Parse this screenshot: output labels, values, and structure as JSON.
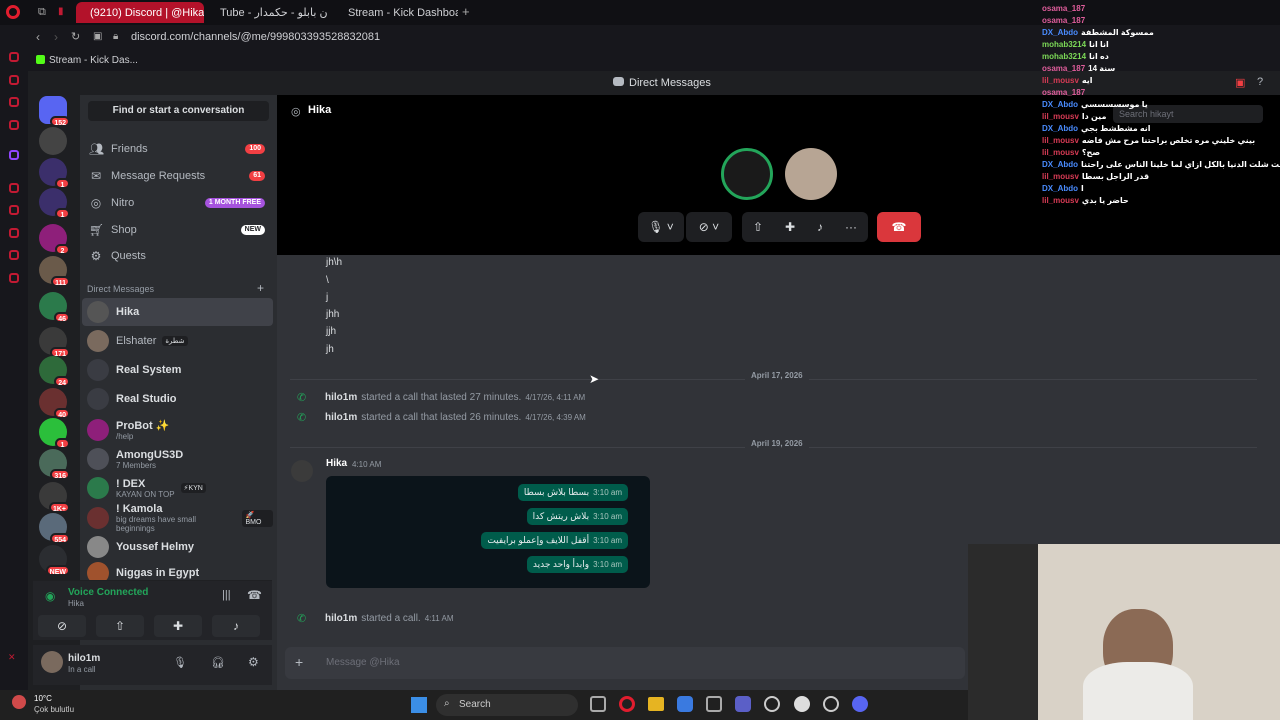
{
  "browser": {
    "tabs": [
      {
        "label": "(9210) Discord | @Hika",
        "active": true
      },
      {
        "label": "Tube - مروان بابلو - حكمدار"
      },
      {
        "label": "Stream - Kick Dashboard"
      }
    ],
    "url": "discord.com/channels/@me/999803393528832081",
    "bookmark": "Stream - Kick Das..."
  },
  "header": {
    "title": "Direct Messages"
  },
  "sidebar": {
    "search_label": "Find or start a conversation",
    "nav": [
      {
        "label": "Friends",
        "icon": "friends-icon",
        "badge": "100"
      },
      {
        "label": "Message Requests",
        "icon": "mail-icon",
        "badge": "61"
      },
      {
        "label": "Nitro",
        "icon": "nitro-icon",
        "badge": "1 MONTH FREE"
      },
      {
        "label": "Shop",
        "icon": "shop-icon",
        "badge": "NEW"
      },
      {
        "label": "Quests",
        "icon": "quests-icon"
      }
    ],
    "dm_header": "Direct Messages",
    "dms": [
      {
        "name": "Hika",
        "sub": ""
      },
      {
        "name": "Elshater",
        "sub": "",
        "tag": "شطرة"
      },
      {
        "name": "Real System",
        "sub": ""
      },
      {
        "name": "Real Studio",
        "sub": ""
      },
      {
        "name": "ProBot ✨",
        "sub": "/help"
      },
      {
        "name": "AmongUS3D",
        "sub": "7 Members"
      },
      {
        "name": "! DEX",
        "sub": "KAYAN ON TOP",
        "tag": "⚡KYN"
      },
      {
        "name": "! Kamola",
        "sub": "big dreams have small beginnings",
        "tag": "🚀BMO"
      },
      {
        "name": "Youssef Helmy",
        "sub": ""
      },
      {
        "name": "Niggas in Egypt",
        "sub": ""
      }
    ]
  },
  "servers": [
    {
      "badge": "152"
    },
    {
      "badge": ""
    },
    {
      "badge": "1"
    },
    {
      "badge": "1"
    },
    {
      "badge": "2"
    },
    {
      "badge": "111"
    },
    {
      "badge": "46"
    },
    {
      "badge": "171"
    },
    {
      "badge": "24"
    },
    {
      "badge": "40"
    },
    {
      "badge": "1"
    },
    {
      "badge": "316"
    },
    {
      "badge": "1K+"
    },
    {
      "badge": "554"
    },
    {
      "badge": "NEW"
    }
  ],
  "voice": {
    "status": "Voice Connected",
    "channel": "Hika"
  },
  "user": {
    "name": "hilo1m",
    "status": "In a call"
  },
  "channel": {
    "name": "Hika",
    "search_placeholder": "Search hikayt"
  },
  "messages": {
    "lines": [
      "jh\\h",
      "\\",
      "j",
      "jhh",
      "jjh",
      "jh"
    ],
    "date1": "April 17, 2026",
    "calls1": [
      {
        "user": "hilo1m",
        "text": "started a call that lasted 27 minutes.",
        "time": "4/17/26, 4:11 AM"
      },
      {
        "user": "hilo1m",
        "text": "started a call that lasted 26 minutes.",
        "time": "4/17/26, 4:39 AM"
      }
    ],
    "date2": "April 19, 2026",
    "author": "Hika",
    "author_time": "4:10 AM",
    "wa_bubbles": [
      {
        "text": "بسطا بلاش بسطا",
        "time": "3:10 am"
      },
      {
        "text": "بلاش ريتش كدا",
        "time": "3:10 am"
      },
      {
        "text": "أقفل اللايف وإعملو برايفيت",
        "time": "3:10 am"
      },
      {
        "text": "وابدأ واحد جديد",
        "time": "3:10 am"
      }
    ],
    "last_call": {
      "user": "hilo1m",
      "text": "started a call.",
      "time": "4:11 AM"
    }
  },
  "input": {
    "placeholder": "Message @Hika"
  },
  "overlay_chat": [
    {
      "user": "osama_187",
      "msg": "",
      "color": "#e05e9c"
    },
    {
      "user": "osama_187",
      "msg": "",
      "color": "#e05e9c"
    },
    {
      "user": "DX_Abdo",
      "msg": "ممسوكة المشطفة",
      "color": "#4a8cff"
    },
    {
      "user": "mohab3214",
      "msg": "انا انا",
      "color": "#7cd957"
    },
    {
      "user": "mohab3214",
      "msg": "ده انا",
      "color": "#7cd957"
    },
    {
      "user": "osama_187",
      "msg": "سنة 14",
      "color": "#e05e9c"
    },
    {
      "user": "lil_mousv",
      "msg": "ايه",
      "color": "#d83b55"
    },
    {
      "user": "osama_187",
      "msg": "",
      "color": "#e05e9c"
    },
    {
      "user": "DX_Abdo",
      "msg": "يا موسسسسسي",
      "color": "#4a8cff"
    },
    {
      "user": "lil_mousv",
      "msg": "مين دا",
      "color": "#d83b55"
    },
    {
      "user": "DX_Abdo",
      "msg": "انه مشطشط بجي",
      "color": "#4a8cff"
    },
    {
      "user": "lil_mousv",
      "msg": "بيني خليني مره تخلص براحتنا مرح مش فاضه",
      "color": "#d83b55"
    },
    {
      "user": "lil_mousv",
      "msg": "صح؟",
      "color": "#d83b55"
    },
    {
      "user": "DX_Abdo",
      "msg": "لا بسطا انت شلت الدنيا بالكل ازاي لما خلينا الناس على راحتنا",
      "color": "#4a8cff"
    },
    {
      "user": "lil_mousv",
      "msg": "قدر الراجل بسطا",
      "color": "#d83b55"
    },
    {
      "user": "DX_Abdo",
      "msg": "ا",
      "color": "#4a8cff"
    },
    {
      "user": "lil_mousv",
      "msg": "حاضر يا بدي",
      "color": "#d83b55"
    }
  ],
  "taskbar": {
    "search": "Search",
    "weather_temp": "10°C",
    "weather_desc": "Çok bulutlu"
  }
}
